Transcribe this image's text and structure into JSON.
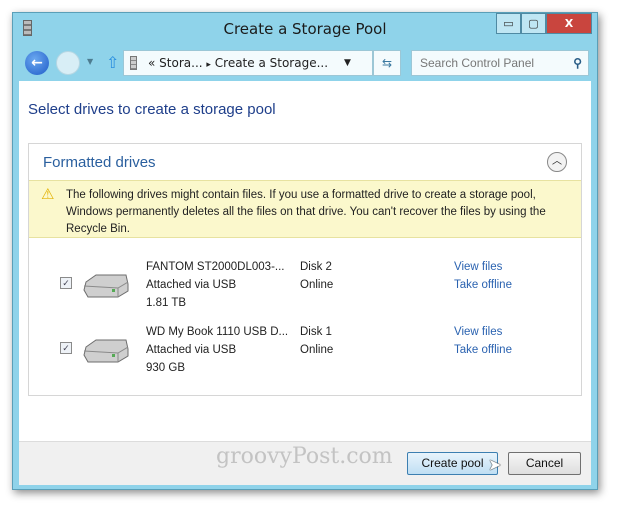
{
  "window": {
    "title": "Create a Storage Pool",
    "minimize": "▭",
    "maximize": "▢",
    "close": "X"
  },
  "nav": {
    "breadcrumb": [
      "«",
      "Stora...",
      "▸",
      "Create a Storage..."
    ],
    "search_placeholder": "Search Control Panel"
  },
  "main": {
    "heading": "Select drives to create a storage pool",
    "section": {
      "title": "Formatted drives",
      "warning": "The following drives might contain files. If you use a formatted drive to create a storage pool, Windows permanently deletes all the files on that drive. You can't recover the files by using the Recycle Bin.",
      "drives": [
        {
          "name": "FANTOM ST2000DL003-...",
          "connection": "Attached via USB",
          "size": "1.81 TB",
          "disk": "Disk 2",
          "status": "Online",
          "checked": true,
          "view": "View files",
          "offline": "Take offline"
        },
        {
          "name": "WD My Book 1110 USB D...",
          "connection": "Attached via USB",
          "size": "930 GB",
          "disk": "Disk 1",
          "status": "Online",
          "checked": true,
          "view": "View files",
          "offline": "Take offline"
        }
      ]
    }
  },
  "footer": {
    "watermark": "groovyPost.com",
    "create": "Create pool",
    "cancel": "Cancel"
  },
  "colors": {
    "frame": "#8fd3ea",
    "heading": "#1e3e8a",
    "link": "#2a62b0",
    "warning_bg": "#fbf8cc"
  }
}
